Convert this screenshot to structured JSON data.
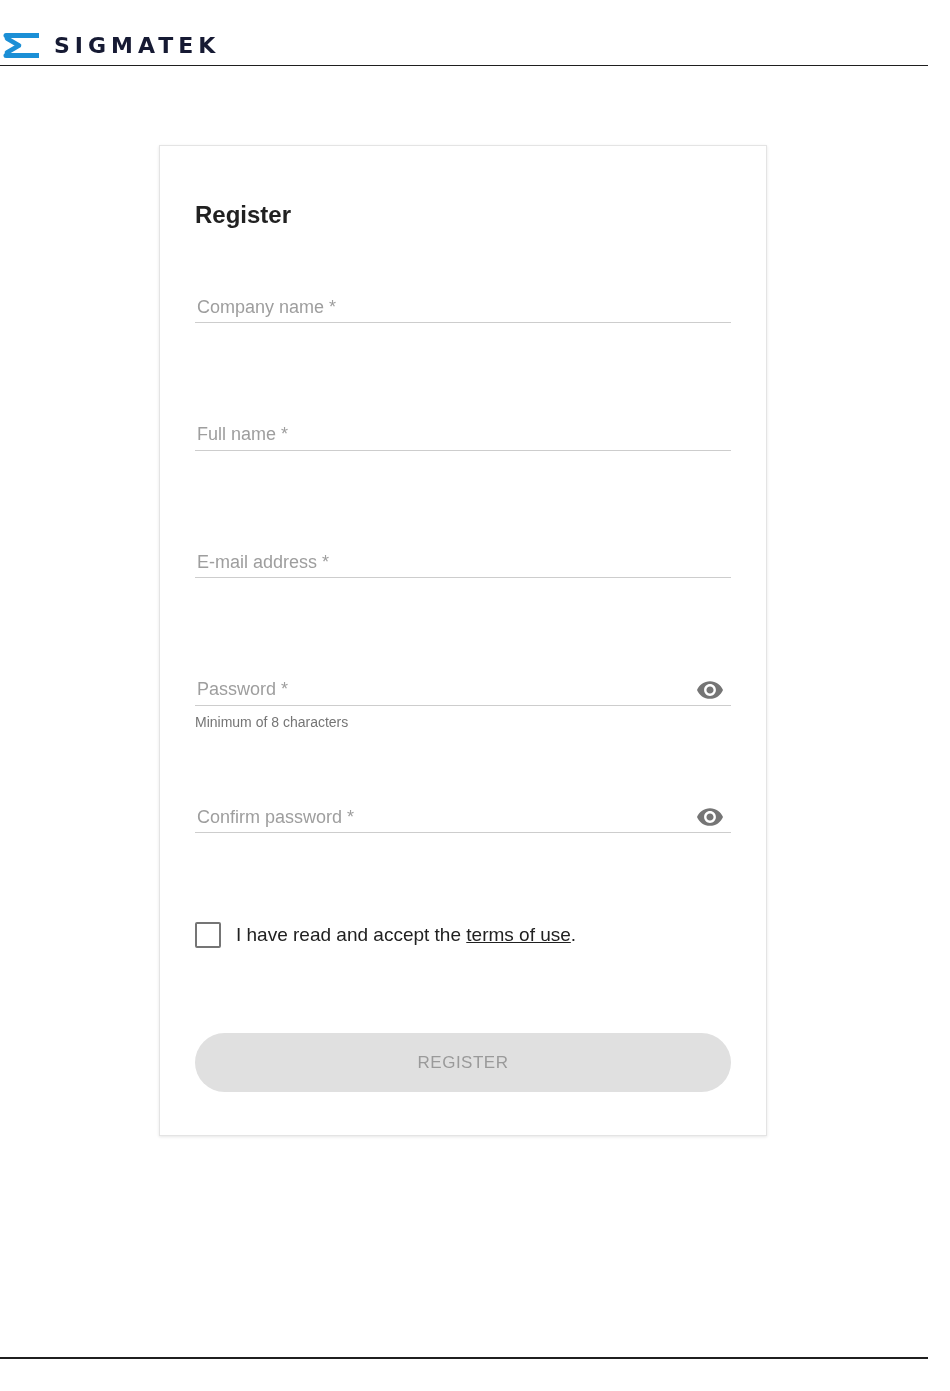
{
  "header": {
    "logo_text": "SIGMATEK"
  },
  "form": {
    "title": "Register",
    "fields": [
      {
        "kind": "text",
        "placeholder": "Company name *"
      },
      {
        "kind": "text",
        "placeholder": "Full name *"
      },
      {
        "kind": "text",
        "placeholder": "E-mail address *"
      },
      {
        "kind": "password",
        "placeholder": "Password *",
        "helper": "Minimum of 8 characters"
      },
      {
        "kind": "password",
        "placeholder": "Confirm password *"
      }
    ],
    "consent": {
      "checked": false,
      "text": "I have read and accept the ",
      "link": "terms of use",
      "text_after": "."
    },
    "submit": {
      "label": "REGISTER",
      "disabled": true
    }
  }
}
